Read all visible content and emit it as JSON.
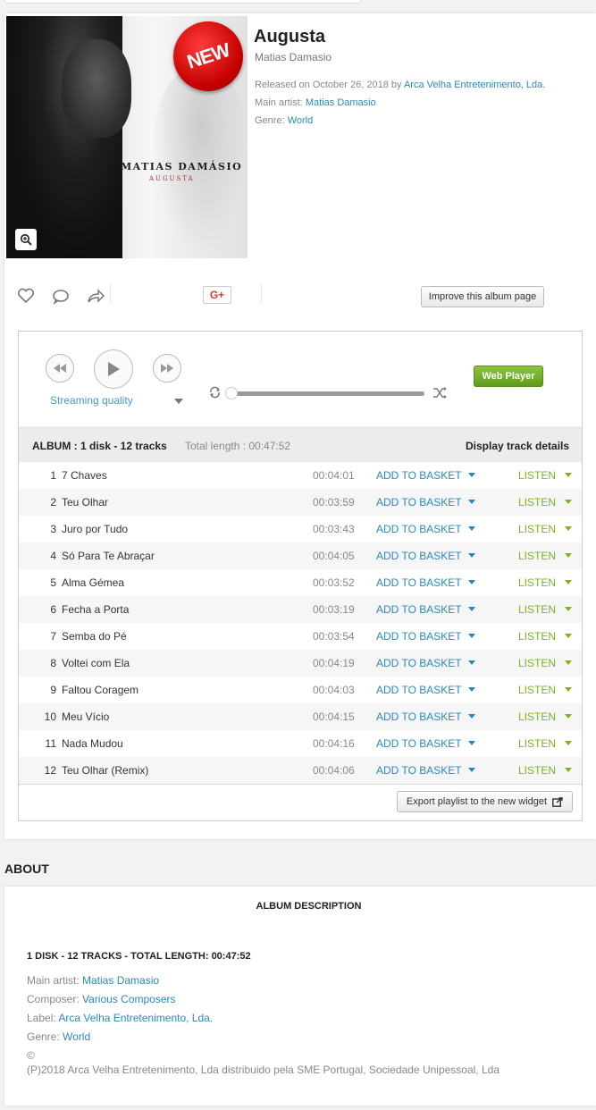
{
  "album": {
    "title": "Augusta",
    "artist": "Matias Damasio",
    "cover_name": "MATIAS DAMÁSIO",
    "cover_subtitle": "AUGUSTA",
    "badge": "NEW",
    "released_prefix": "Released on October 26, 2018 by ",
    "label": "Arca Velha Entretenimento, Lda.",
    "main_artist_prefix": "Main artist: ",
    "genre_prefix": "Genre: ",
    "genre": "World"
  },
  "toolbar": {
    "gplus_label": "G+",
    "improve_label": "Improve this album page"
  },
  "player": {
    "streaming_quality_label": "Streaming quality",
    "web_player_label": "Web Player",
    "progress": 0
  },
  "tracklist": {
    "header_album": "ALBUM : 1 disk - 12 tracks",
    "header_length": "Total length : 00:47:52",
    "header_details": "Display track details",
    "basket_label": "ADD TO BASKET",
    "listen_label": "LISTEN",
    "tracks": [
      {
        "num": "1",
        "name": "7 Chaves",
        "dur": "00:04:01"
      },
      {
        "num": "2",
        "name": "Teu Olhar",
        "dur": "00:03:59"
      },
      {
        "num": "3",
        "name": "Juro por Tudo",
        "dur": "00:03:43"
      },
      {
        "num": "4",
        "name": "Só Para Te Abraçar",
        "dur": "00:04:05"
      },
      {
        "num": "5",
        "name": "Alma Gémea",
        "dur": "00:03:52"
      },
      {
        "num": "6",
        "name": "Fecha a Porta",
        "dur": "00:03:19"
      },
      {
        "num": "7",
        "name": "Semba do Pé",
        "dur": "00:03:54"
      },
      {
        "num": "8",
        "name": "Voltei com Ela",
        "dur": "00:04:19"
      },
      {
        "num": "9",
        "name": "Faltou Coragem",
        "dur": "00:04:03"
      },
      {
        "num": "10",
        "name": "Meu Vício",
        "dur": "00:04:15"
      },
      {
        "num": "11",
        "name": "Nada Mudou",
        "dur": "00:04:16"
      },
      {
        "num": "12",
        "name": "Teu Olhar (Remix)",
        "dur": "00:04:06"
      }
    ],
    "export_label": "Export playlist to the new widget"
  },
  "about": {
    "heading": "ABOUT",
    "description_title": "ALBUM DESCRIPTION",
    "summary": "1 DISK - 12 TRACKS - TOTAL LENGTH: 00:47:52",
    "main_artist_prefix": "Main artist: ",
    "main_artist": "Matias Damasio",
    "composer_prefix": "Composer: ",
    "composer": "Various Composers",
    "label_prefix": "Label: ",
    "label": "Arca Velha Entretenimento, Lda.",
    "genre_prefix": "Genre: ",
    "genre": "World",
    "copyright_symbol": "©",
    "copyright_line": "(P)2018 Arca Velha Entretenimento, Lda distribuido pela SME Portugal, Sociedade Unipessoal, Lda"
  }
}
